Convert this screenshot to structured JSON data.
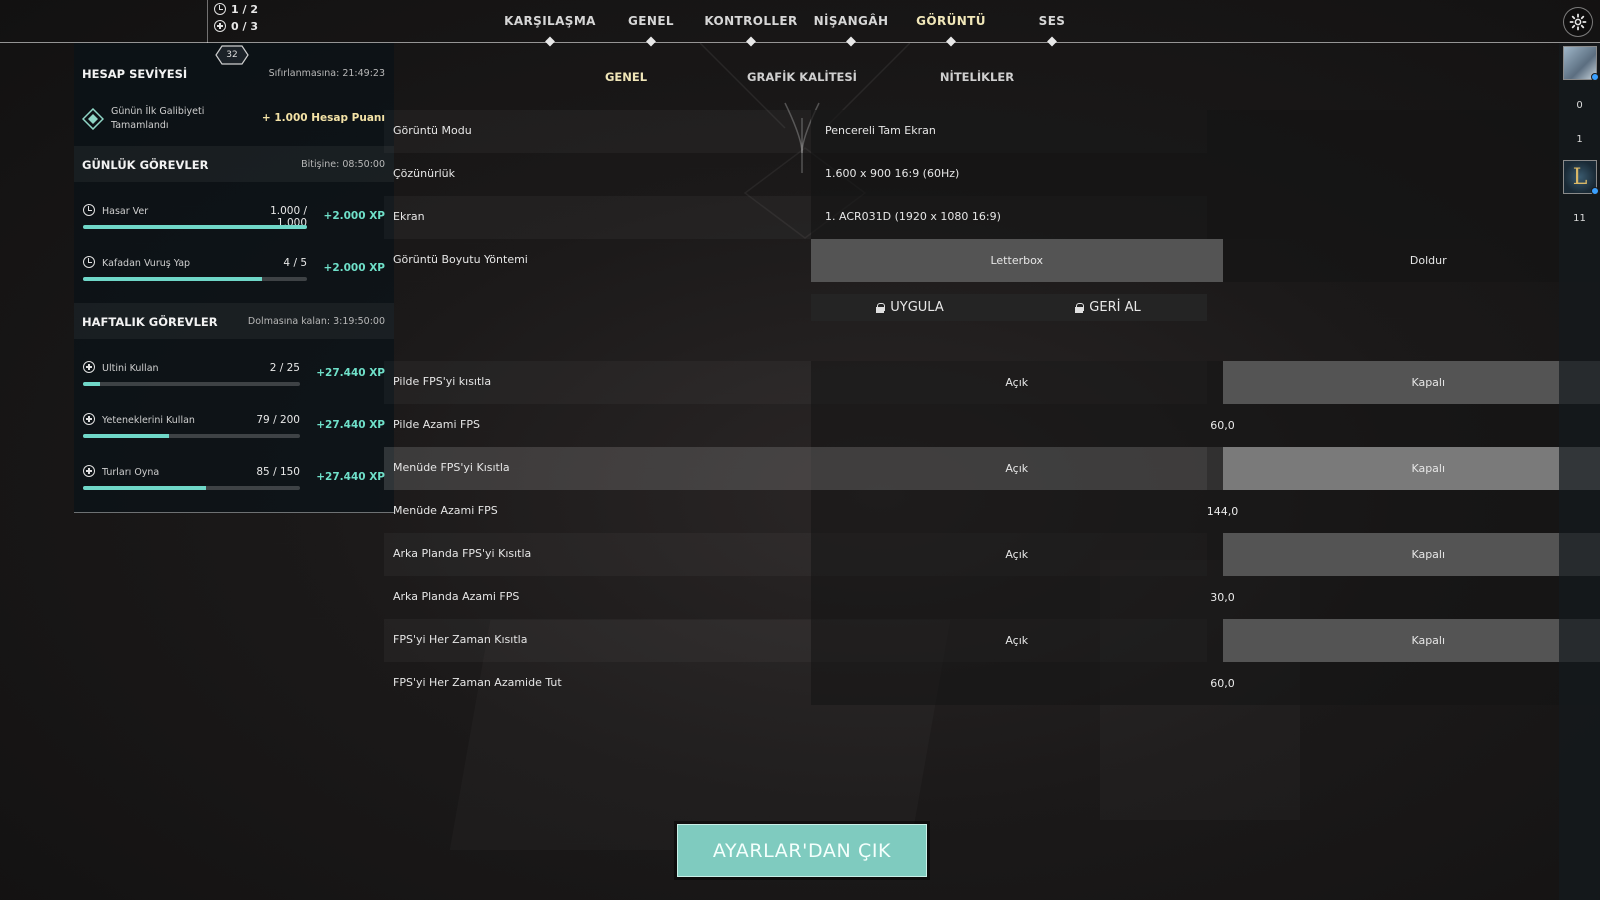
{
  "topnav": {
    "tabs": [
      "KARŞILAŞMA",
      "GENEL",
      "KONTROLLER",
      "NİŞANGÂH",
      "GÖRÜNTÜ",
      "SES"
    ],
    "active_tab": "GÖRÜNTÜ",
    "counters": {
      "clock": "1 / 2",
      "plus": "0 / 3"
    }
  },
  "subtabs": {
    "items": [
      "GENEL",
      "GRAFİK KALİTESİ",
      "NİTELİKLER"
    ],
    "active": "GENEL"
  },
  "panel": {
    "level": "32",
    "account": {
      "title": "HESAP SEVİYESİ",
      "timer": "Sıfırlanmasına: 21:49:23",
      "first_win_text": "Günün İlk Galibiyeti Tamamlandı",
      "first_win_points": "+ 1.000 Hesap Puanı"
    },
    "daily": {
      "title": "GÜNLÜK GÖREVLER",
      "timer": "Bitişine: 08:50:00",
      "quests": [
        {
          "name": "Hasar Ver",
          "progress": "1.000 / 1.000",
          "fraction": 1.0,
          "xp": "+2.000 XP",
          "icon": "clock-icon"
        },
        {
          "name": "Kafadan Vuruş Yap",
          "progress": "4 / 5",
          "fraction": 0.8,
          "xp": "+2.000 XP",
          "icon": "clock-icon"
        }
      ]
    },
    "weekly": {
      "title": "HAFTALIK GÖREVLER",
      "timer": "Dolmasına kalan: 3:19:50:00",
      "quests": [
        {
          "name": "Ultini Kullan",
          "progress": "2 / 25",
          "fraction": 0.08,
          "xp": "+27.440 XP",
          "icon": "plus-circle-icon"
        },
        {
          "name": "Yeteneklerini Kullan",
          "progress": "79 / 200",
          "fraction": 0.395,
          "xp": "+27.440 XP",
          "icon": "plus-circle-icon"
        },
        {
          "name": "Turları Oyna",
          "progress": "85 / 150",
          "fraction": 0.567,
          "xp": "+27.440 XP",
          "icon": "plus-circle-icon"
        }
      ]
    }
  },
  "settings": {
    "display_mode": {
      "label": "Görüntü Modu",
      "value": "Pencereli Tam Ekran"
    },
    "resolution": {
      "label": "Çözünürlük",
      "value": "1.600 x 900 16:9 (60Hz)"
    },
    "monitor": {
      "label": "Ekran",
      "value": "1. ACR031D (1920 x  1080 16:9)"
    },
    "aspect_method": {
      "label": "Görüntü Boyutu Yöntemi",
      "options": [
        "Letterbox",
        "Doldur"
      ],
      "selected": "Letterbox"
    },
    "apply_label": "UYGULA",
    "revert_label": "GERİ AL",
    "limit_fps_battery": {
      "label": "Pilde FPS'yi kısıtla",
      "options": [
        "Açık",
        "Kapalı"
      ],
      "selected": "Kapalı"
    },
    "max_fps_battery": {
      "label": "Pilde Azami FPS",
      "value": "60,0"
    },
    "limit_fps_menu": {
      "label": "Menüde FPS'yi Kısıtla",
      "options": [
        "Açık",
        "Kapalı"
      ],
      "selected": "Kapalı"
    },
    "max_fps_menu": {
      "label": "Menüde Azami FPS",
      "value": "144,0"
    },
    "limit_fps_background": {
      "label": "Arka Planda FPS'yi Kısıtla",
      "options": [
        "Açık",
        "Kapalı"
      ],
      "selected": "Kapalı"
    },
    "max_fps_background": {
      "label": "Arka Planda Azami FPS",
      "value": "30,0"
    },
    "limit_fps_always": {
      "label": "FPS'yi Her Zaman Kısıtla",
      "options": [
        "Açık",
        "Kapalı"
      ],
      "selected": "Kapalı"
    },
    "max_fps_always": {
      "label": "FPS'yi Her Zaman Azamide Tut",
      "value": "60,0"
    }
  },
  "exit_button": "AYARLAR'DAN ÇIK",
  "sidebar": {
    "counts": [
      "0",
      "1",
      "11"
    ]
  },
  "colors": {
    "accent_teal": "#6fe0c9",
    "exit_button": "#7fcbbf",
    "active_tab": "#f0e6b8",
    "online_dot": "#3aa0ff"
  }
}
